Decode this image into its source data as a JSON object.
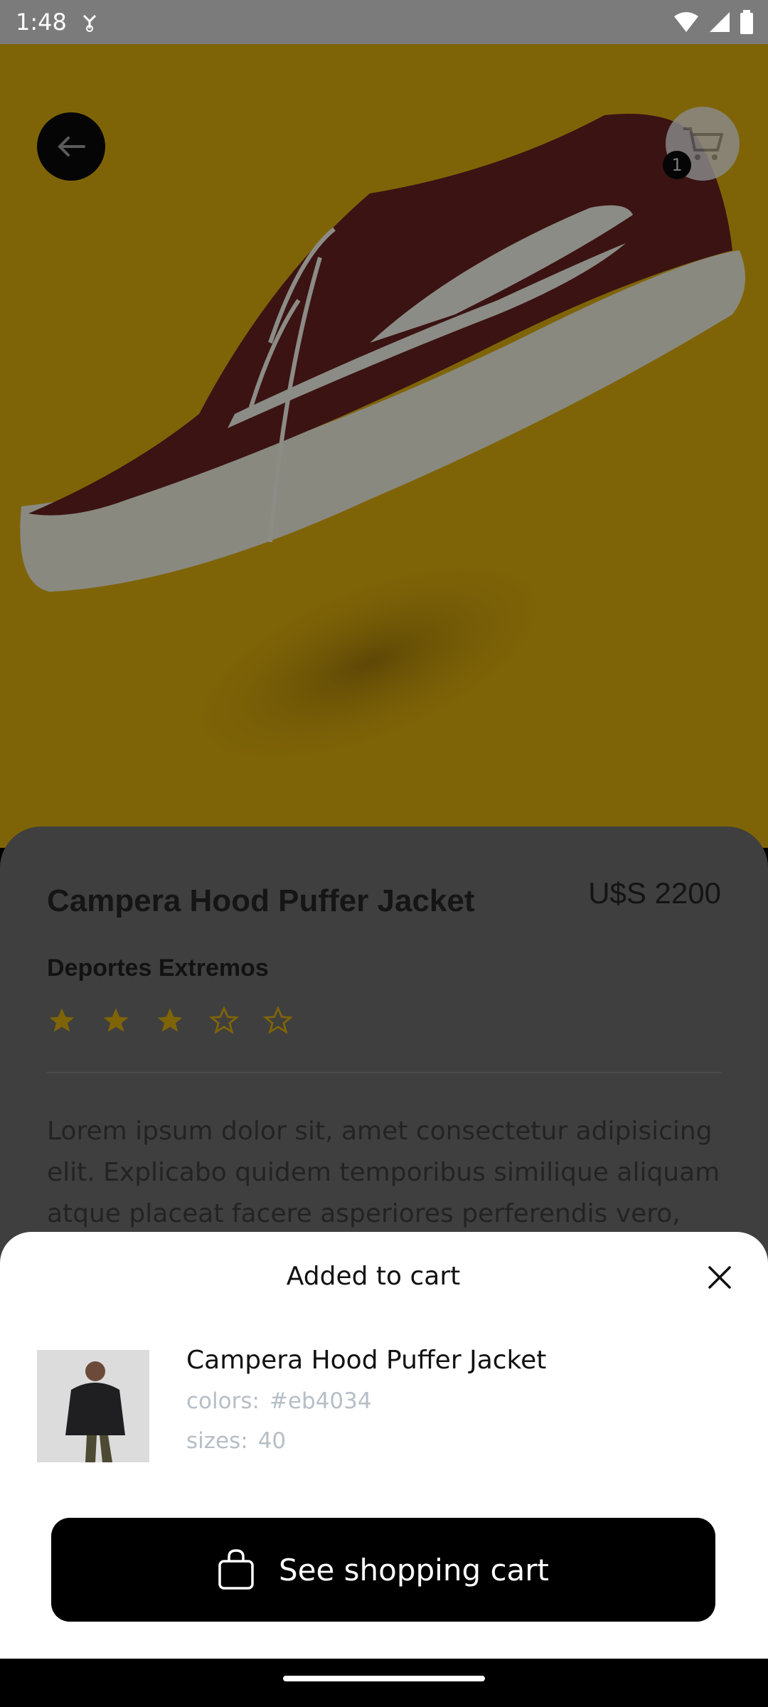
{
  "status_bar": {
    "time": "1:48",
    "icons": [
      "notification-icon",
      "wifi-icon",
      "signal-icon",
      "battery-icon"
    ]
  },
  "hero": {
    "background_color": "#7f6407",
    "image": "sneaker-image"
  },
  "header": {
    "back_icon": "arrow-left-icon",
    "cart_icon": "cart-icon",
    "cart_count": "1"
  },
  "product": {
    "title": "Campera Hood Puffer Jacket",
    "price": "U$S 2200",
    "brand": "Deportes Extremos",
    "rating": 3,
    "rating_max": 5,
    "description": "Lorem ipsum dolor sit, amet consectetur adipisicing elit. Explicabo quidem temporibus similique aliquam atque placeat facere asperiores perferendis vero,"
  },
  "sheet": {
    "title": "Added to cart",
    "close_icon": "close-icon",
    "item": {
      "name": "Campera Hood Puffer Jacket",
      "colors_label": "colors:",
      "colors_value": "#eb4034",
      "sizes_label": "sizes:",
      "sizes_value": "40"
    },
    "cta_label": "See shopping cart",
    "cta_icon": "shopping-bag-icon"
  },
  "colors": {
    "accent": "#000000",
    "muted_text": "#b6bec6",
    "overlay_hero": "#7f6407",
    "overlay_card": "#3f3f3f"
  }
}
